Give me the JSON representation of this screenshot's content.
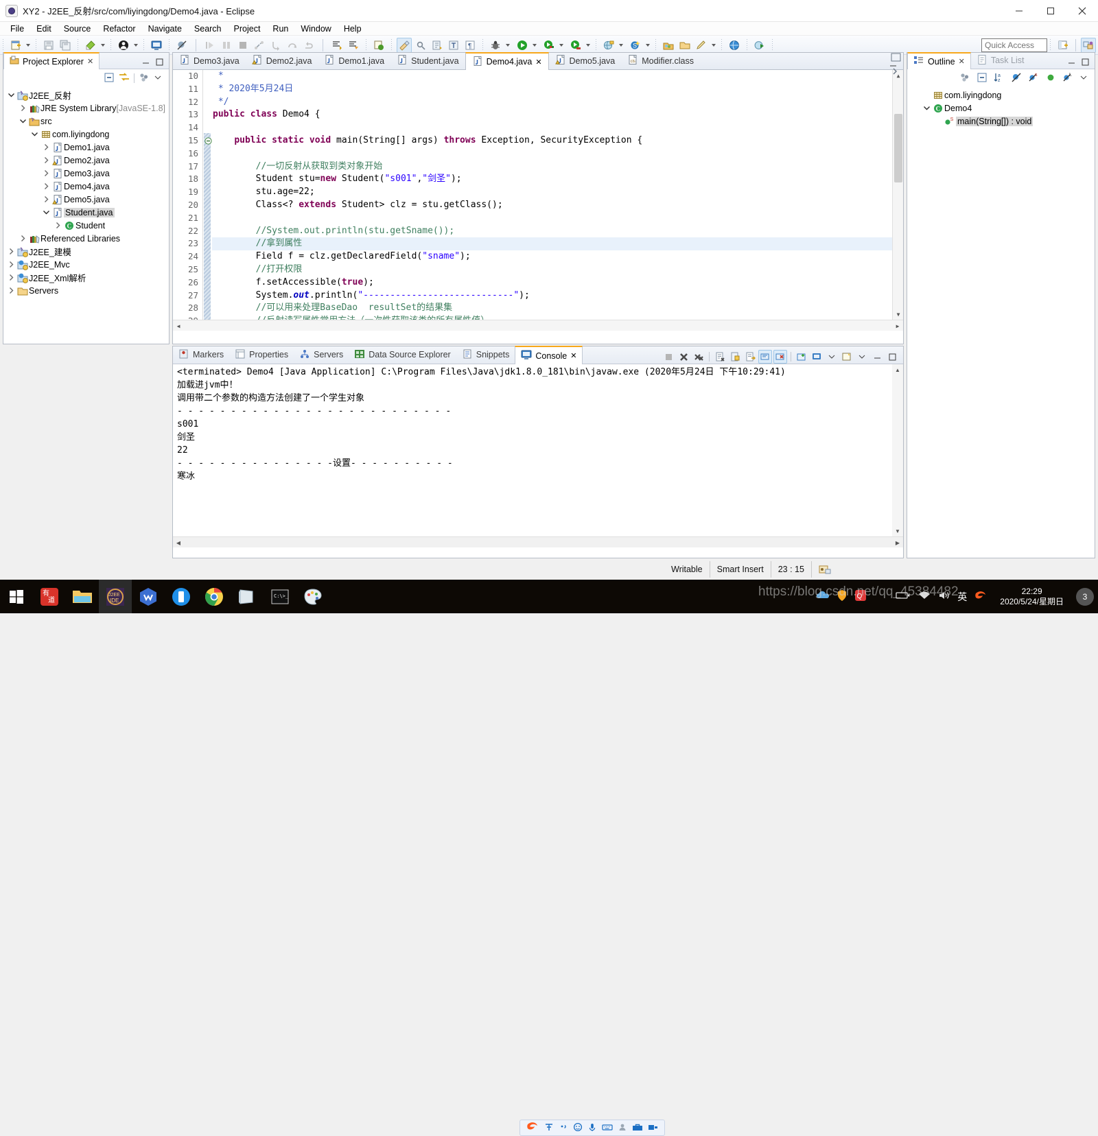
{
  "window": {
    "title": "XY2 - J2EE_反射/src/com/liyingdong/Demo4.java - Eclipse",
    "app_icon": "eclipse-icon",
    "minimize": "–",
    "maximize": "□",
    "close": "✕"
  },
  "menubar": {
    "items": [
      {
        "label": "File"
      },
      {
        "label": "Edit"
      },
      {
        "label": "Source"
      },
      {
        "label": "Refactor"
      },
      {
        "label": "Navigate"
      },
      {
        "label": "Search"
      },
      {
        "label": "Project"
      },
      {
        "label": "Run"
      },
      {
        "label": "Window"
      },
      {
        "label": "Help"
      }
    ]
  },
  "toolbar": {
    "quick_access_placeholder": "Quick Access"
  },
  "project_explorer": {
    "tab_label": "Project Explorer",
    "close_glyph": "✕",
    "tree": [
      {
        "depth": 0,
        "label": "J2EE_反射",
        "icon": "java-project-icon",
        "twist": "down"
      },
      {
        "depth": 1,
        "label": "JRE System Library",
        "suffix": " [JavaSE-1.8]",
        "icon": "library-icon",
        "twist": "right"
      },
      {
        "depth": 1,
        "label": "src",
        "icon": "source-folder-icon",
        "twist": "down"
      },
      {
        "depth": 2,
        "label": "com.liyingdong",
        "icon": "package-icon",
        "twist": "down"
      },
      {
        "depth": 3,
        "label": "Demo1.java",
        "icon": "java-file-icon",
        "twist": "right"
      },
      {
        "depth": 3,
        "label": "Demo2.java",
        "icon": "java-file-warning-icon",
        "twist": "right"
      },
      {
        "depth": 3,
        "label": "Demo3.java",
        "icon": "java-file-icon",
        "twist": "right"
      },
      {
        "depth": 3,
        "label": "Demo4.java",
        "icon": "java-file-icon",
        "twist": "right"
      },
      {
        "depth": 3,
        "label": "Demo5.java",
        "icon": "java-file-warning-icon",
        "twist": "right"
      },
      {
        "depth": 3,
        "label": "Student.java",
        "icon": "java-file-icon",
        "twist": "down",
        "selected": true
      },
      {
        "depth": 4,
        "label": "Student",
        "icon": "class-icon",
        "twist": "right"
      },
      {
        "depth": 1,
        "label": "Referenced Libraries",
        "icon": "library-icon",
        "twist": "right"
      },
      {
        "depth": 0,
        "label": "J2EE_建模",
        "icon": "java-project-icon",
        "twist": "right"
      },
      {
        "depth": 0,
        "label": "J2EE_Mvc",
        "icon": "web-project-icon",
        "twist": "right"
      },
      {
        "depth": 0,
        "label": "J2EE_Xml解析",
        "icon": "web-project-icon",
        "twist": "right"
      },
      {
        "depth": 0,
        "label": "Servers",
        "icon": "folder-icon",
        "twist": "right"
      }
    ]
  },
  "editor": {
    "tabs": [
      {
        "label": "Demo3.java",
        "icon": "java-file-icon",
        "active": false
      },
      {
        "label": "Demo2.java",
        "icon": "java-file-warning-icon",
        "active": false
      },
      {
        "label": "Demo1.java",
        "icon": "java-file-icon",
        "active": false
      },
      {
        "label": "Student.java",
        "icon": "java-file-icon",
        "active": false
      },
      {
        "label": "Demo4.java",
        "icon": "java-file-icon",
        "active": true,
        "close_glyph": "✕"
      },
      {
        "label": "Demo5.java",
        "icon": "java-file-warning-icon",
        "active": false
      },
      {
        "label": "Modifier.class",
        "icon": "class-file-icon",
        "active": false
      }
    ],
    "first_line_number": 10,
    "highlight_line": 23,
    "lines": [
      {
        "n": 10,
        "tokens": [
          {
            "t": " * ",
            "c": "jdoc"
          }
        ]
      },
      {
        "n": 11,
        "tokens": [
          {
            "t": " * 2020年5月24日",
            "c": "jdoc"
          }
        ]
      },
      {
        "n": 12,
        "tokens": [
          {
            "t": " */",
            "c": "jdoc"
          }
        ]
      },
      {
        "n": 13,
        "tokens": [
          {
            "t": "public class ",
            "c": "kw"
          },
          {
            "t": "Demo4 {",
            "c": "pln"
          }
        ]
      },
      {
        "n": 14,
        "tokens": [
          {
            "t": "",
            "c": "pln"
          }
        ]
      },
      {
        "n": 15,
        "fold": true,
        "tokens": [
          {
            "t": "    ",
            "c": "pln"
          },
          {
            "t": "public static void ",
            "c": "kw"
          },
          {
            "t": "main(String[] args) ",
            "c": "pln"
          },
          {
            "t": "throws ",
            "c": "kw"
          },
          {
            "t": "Exception, SecurityException {",
            "c": "pln"
          }
        ]
      },
      {
        "n": 16,
        "tokens": [
          {
            "t": "",
            "c": "pln"
          }
        ]
      },
      {
        "n": 17,
        "tokens": [
          {
            "t": "        //一切反射从获取到类对象开始",
            "c": "cmt"
          }
        ]
      },
      {
        "n": 18,
        "tokens": [
          {
            "t": "        Student stu=",
            "c": "pln"
          },
          {
            "t": "new ",
            "c": "kw"
          },
          {
            "t": "Student(",
            "c": "pln"
          },
          {
            "t": "\"s001\"",
            "c": "str"
          },
          {
            "t": ",",
            "c": "pln"
          },
          {
            "t": "\"剑圣\"",
            "c": "str"
          },
          {
            "t": ");",
            "c": "pln"
          }
        ]
      },
      {
        "n": 19,
        "tokens": [
          {
            "t": "        stu.age=22;",
            "c": "pln"
          }
        ]
      },
      {
        "n": 20,
        "tokens": [
          {
            "t": "        Class<? ",
            "c": "pln"
          },
          {
            "t": "extends ",
            "c": "kw"
          },
          {
            "t": "Student> clz = stu.getClass();",
            "c": "pln"
          }
        ]
      },
      {
        "n": 21,
        "tokens": [
          {
            "t": "",
            "c": "pln"
          }
        ]
      },
      {
        "n": 22,
        "tokens": [
          {
            "t": "        //System.out.println(stu.getSname());",
            "c": "cmt"
          }
        ]
      },
      {
        "n": 23,
        "tokens": [
          {
            "t": "        //拿到属性",
            "c": "cmt"
          }
        ]
      },
      {
        "n": 24,
        "tokens": [
          {
            "t": "        Field f = clz.getDeclaredField(",
            "c": "pln"
          },
          {
            "t": "\"sname\"",
            "c": "str"
          },
          {
            "t": ");",
            "c": "pln"
          }
        ]
      },
      {
        "n": 25,
        "tokens": [
          {
            "t": "        //打开权限",
            "c": "cmt"
          }
        ]
      },
      {
        "n": 26,
        "tokens": [
          {
            "t": "        f.setAccessible(",
            "c": "pln"
          },
          {
            "t": "true",
            "c": "kw"
          },
          {
            "t": ");",
            "c": "pln"
          }
        ]
      },
      {
        "n": 27,
        "tokens": [
          {
            "t": "        System.",
            "c": "pln"
          },
          {
            "t": "out",
            "c": "fld"
          },
          {
            "t": ".println(",
            "c": "pln"
          },
          {
            "t": "\"----------------------------\"",
            "c": "str"
          },
          {
            "t": ");",
            "c": "pln"
          }
        ]
      },
      {
        "n": 28,
        "tokens": [
          {
            "t": "        //可以用来处理BaseDao  resultSet的结果集",
            "c": "cmt"
          }
        ]
      },
      {
        "n": 29,
        "tokens": [
          {
            "t": "        //反射读写属性常用方法（一次性获取该类的所有属性值）",
            "c": "cmt"
          }
        ]
      }
    ]
  },
  "bottom_panel": {
    "tabs": [
      {
        "label": "Markers",
        "icon": "markers-icon",
        "active": false
      },
      {
        "label": "Properties",
        "icon": "properties-icon",
        "active": false
      },
      {
        "label": "Servers",
        "icon": "servers-icon",
        "active": false
      },
      {
        "label": "Data Source Explorer",
        "icon": "data-source-icon",
        "active": false
      },
      {
        "label": "Snippets",
        "icon": "snippets-icon",
        "active": false
      },
      {
        "label": "Console",
        "icon": "console-icon",
        "active": true,
        "close_glyph": "✕"
      }
    ],
    "console": {
      "launch_line": "<terminated> Demo4 [Java Application] C:\\Program Files\\Java\\jdk1.8.0_181\\bin\\javaw.exe (2020年5月24日 下午10:29:41)",
      "output": [
        "加载进jvm中！",
        "调用带二个参数的构造方法创建了一个学生对象",
        "- - - - - - - - - - - - - - - - - - - - - - - - - -",
        "s001",
        "剑圣",
        "22",
        "- - - - - - - - - - - - - - -设置- - - - - - - - - -",
        "寒冰"
      ]
    }
  },
  "outline": {
    "tabs": [
      {
        "label": "Outline",
        "icon": "outline-icon",
        "active": true,
        "close_glyph": "✕"
      },
      {
        "label": "Task List",
        "icon": "task-list-icon",
        "active": false
      }
    ],
    "tree": [
      {
        "depth": 1,
        "label": "com.liyingdong",
        "icon": "package-icon",
        "twist": "none"
      },
      {
        "depth": 1,
        "label": "Demo4",
        "icon": "class-icon",
        "twist": "down"
      },
      {
        "depth": 2,
        "label": "main(String[]) : void",
        "icon": "public-method-static-icon",
        "twist": "none",
        "selected": true
      }
    ]
  },
  "statusbar": {
    "writable": "Writable",
    "insert_mode": "Smart Insert",
    "position": "23 : 15",
    "ime_mode": "英"
  },
  "taskbar": {
    "items": [
      {
        "name": "start-button",
        "icon": "windows-logo-icon"
      },
      {
        "name": "youdao",
        "icon": "youdao-icon"
      },
      {
        "name": "file-explorer",
        "icon": "folder-icon"
      },
      {
        "name": "eclipse-j2ee",
        "icon": "eclipse-ide-icon",
        "active": true
      },
      {
        "name": "wechat",
        "icon": "wechat-work-icon"
      },
      {
        "name": "phone-app",
        "icon": "phone-icon"
      },
      {
        "name": "chrome",
        "icon": "chrome-icon"
      },
      {
        "name": "notepad-app",
        "icon": "notes-icon"
      },
      {
        "name": "terminal",
        "icon": "terminal-icon"
      },
      {
        "name": "paint",
        "icon": "paint-icon"
      }
    ],
    "tray": [
      "onedrive-icon",
      "security-icon",
      "qq-icon",
      "battery-icon",
      "wifi-icon",
      "volume-icon",
      "ime-icon",
      "sogou-icon"
    ],
    "clock_time": "22:29",
    "clock_date": "2020/5/24/星期日",
    "notification_count": "3"
  },
  "watermark": "https://blog.csdn.net/qq_45384482"
}
